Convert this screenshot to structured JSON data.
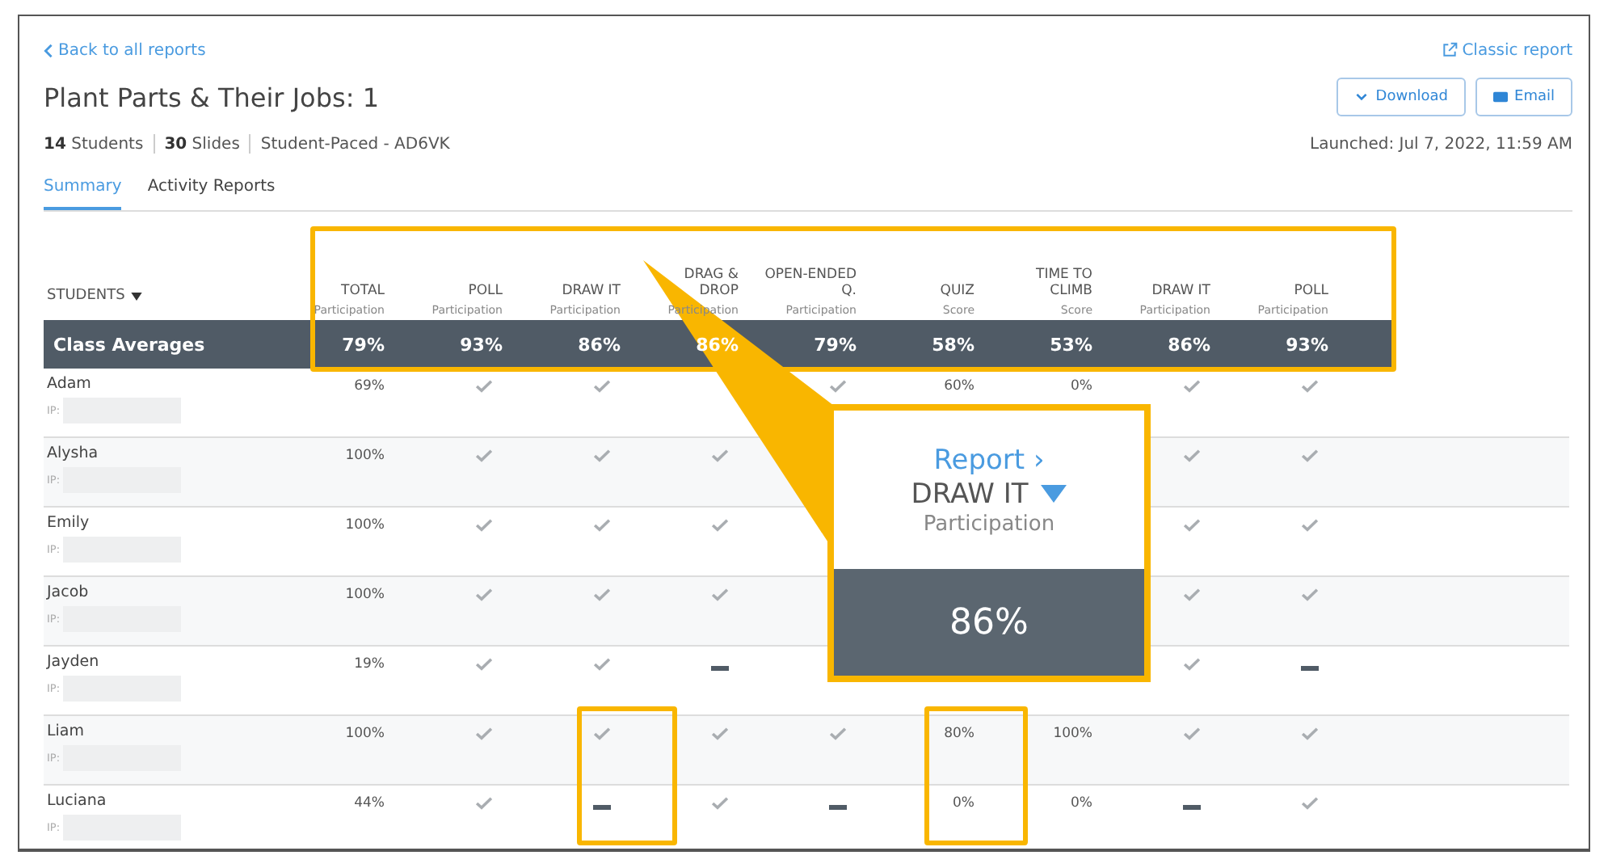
{
  "back_link": "Back to all reports",
  "classic_link": "Classic report",
  "title": "Plant Parts & Their Jobs: 1",
  "buttons": [
    {
      "label": "Download",
      "kind": "download"
    },
    {
      "label": "Email",
      "kind": "email"
    }
  ],
  "meta": [
    {
      "count": "14",
      "label": "Students"
    },
    {
      "count": "30",
      "label": "Slides"
    },
    {
      "label": "Student-Paced - AD6VK"
    }
  ],
  "launched": "Launched: Jul 7, 2022, 11:59 AM",
  "tabs": [
    {
      "label": "Summary",
      "selected": true
    },
    {
      "label": "Activity Reports",
      "selected": false
    }
  ],
  "table": {
    "students_header": "STUDENTS",
    "columns": [
      {
        "title": "TOTAL",
        "sub": "Participation"
      },
      {
        "title": "POLL",
        "sub": "Participation"
      },
      {
        "title": "DRAW IT",
        "sub": "Participation"
      },
      {
        "title": "DRAG & DROP",
        "sub": "Participation"
      },
      {
        "title": "OPEN-ENDED Q.",
        "sub": "Participation"
      },
      {
        "title": "QUIZ",
        "sub": "Score"
      },
      {
        "title": "TIME TO CLIMB",
        "sub": "Score"
      },
      {
        "title": "DRAW IT",
        "sub": "Participation"
      },
      {
        "title": "POLL",
        "sub": "Participation"
      }
    ],
    "averages": {
      "label": "Class Averages",
      "values": [
        "79%",
        "93%",
        "86%",
        "86%",
        "79%",
        "58%",
        "53%",
        "86%",
        "93%"
      ]
    },
    "rows": [
      {
        "name": "Adam",
        "ip": "IP:",
        "cells": [
          {
            "kind": "text",
            "text": "69%"
          },
          {
            "kind": "check"
          },
          {
            "kind": "check"
          },
          null,
          {
            "kind": "check"
          },
          {
            "kind": "text",
            "text": "60%"
          },
          {
            "kind": "text",
            "text": "0%"
          },
          {
            "kind": "check"
          },
          {
            "kind": "check"
          }
        ]
      },
      {
        "name": "Alysha",
        "ip": "IP:",
        "cells": [
          {
            "kind": "text",
            "text": "100%"
          },
          {
            "kind": "check"
          },
          {
            "kind": "check"
          },
          {
            "kind": "check"
          },
          null,
          null,
          null,
          {
            "kind": "check"
          },
          {
            "kind": "check"
          }
        ]
      },
      {
        "name": "Emily",
        "ip": "IP:",
        "cells": [
          {
            "kind": "text",
            "text": "100%"
          },
          {
            "kind": "check"
          },
          {
            "kind": "check"
          },
          {
            "kind": "check"
          },
          null,
          null,
          null,
          {
            "kind": "check"
          },
          {
            "kind": "check"
          }
        ]
      },
      {
        "name": "Jacob",
        "ip": "IP:",
        "cells": [
          {
            "kind": "text",
            "text": "100%"
          },
          {
            "kind": "check"
          },
          {
            "kind": "check"
          },
          {
            "kind": "check"
          },
          null,
          null,
          null,
          {
            "kind": "check"
          },
          {
            "kind": "check"
          }
        ]
      },
      {
        "name": "Jayden",
        "ip": "IP:",
        "cells": [
          {
            "kind": "text",
            "text": "19%"
          },
          {
            "kind": "check"
          },
          {
            "kind": "check"
          },
          {
            "kind": "dash"
          },
          null,
          null,
          null,
          {
            "kind": "check"
          },
          {
            "kind": "dash"
          }
        ]
      },
      {
        "name": "Liam",
        "ip": "IP:",
        "cells": [
          {
            "kind": "text",
            "text": "100%"
          },
          {
            "kind": "check"
          },
          {
            "kind": "check"
          },
          {
            "kind": "check"
          },
          {
            "kind": "check"
          },
          {
            "kind": "text",
            "text": "80%"
          },
          {
            "kind": "text",
            "text": "100%"
          },
          {
            "kind": "check"
          },
          {
            "kind": "check"
          }
        ]
      },
      {
        "name": "Luciana",
        "ip": "IP:",
        "cells": [
          {
            "kind": "text",
            "text": "44%"
          },
          {
            "kind": "check"
          },
          {
            "kind": "dash"
          },
          {
            "kind": "check"
          },
          {
            "kind": "dash"
          },
          {
            "kind": "text",
            "text": "0%"
          },
          {
            "kind": "text",
            "text": "0%"
          },
          {
            "kind": "dash"
          },
          {
            "kind": "check"
          }
        ]
      }
    ]
  },
  "callout": {
    "link": "Report ›",
    "title": "DRAW IT",
    "subtitle": "Participation",
    "value": "86%"
  }
}
